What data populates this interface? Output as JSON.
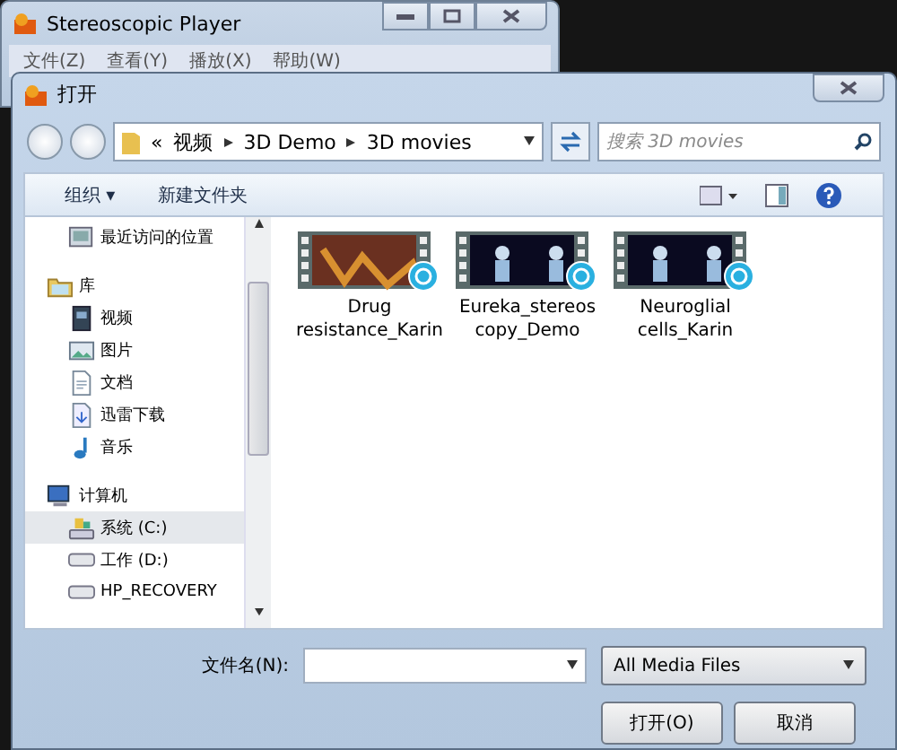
{
  "back_window": {
    "title": "Stereoscopic Player",
    "menu": [
      "文件(Z)",
      "查看(Y)",
      "播放(X)",
      "帮助(W)"
    ]
  },
  "dialog": {
    "title": "打开",
    "breadcrumb": {
      "overflow": "«",
      "parts": [
        "视频",
        "3D Demo",
        "3D movies"
      ]
    },
    "search": {
      "placeholder": "搜索 3D movies"
    },
    "toolbar": [
      "组织 ▾",
      "新建文件夹"
    ],
    "nav": [
      {
        "label": "最近访问的位置",
        "kind": "recent",
        "selected": false
      },
      {
        "label": "库",
        "kind": "library",
        "selected": false,
        "children": [
          {
            "label": "视频",
            "kind": "video",
            "selected": false
          },
          {
            "label": "图片",
            "kind": "picture",
            "selected": false
          },
          {
            "label": "文档",
            "kind": "document",
            "selected": false
          },
          {
            "label": "迅雷下载",
            "kind": "download",
            "selected": false
          },
          {
            "label": "音乐",
            "kind": "music",
            "selected": false
          }
        ]
      },
      {
        "label": "计算机",
        "kind": "computer",
        "selected": false,
        "children": [
          {
            "label": "系统 (C:)",
            "kind": "system-drive",
            "selected": true
          },
          {
            "label": "工作 (D:)",
            "kind": "drive",
            "selected": false
          },
          {
            "label": "HP_RECOVERY",
            "kind": "drive",
            "selected": false
          }
        ]
      }
    ],
    "files": [
      {
        "name_lines": [
          "Drug",
          "resistance_Karin"
        ],
        "kind": "warm"
      },
      {
        "name_lines": [
          "Eureka_stereos",
          "copy_Demo"
        ],
        "kind": "dark"
      },
      {
        "name_lines": [
          "Neuroglial",
          "cells_Karin"
        ],
        "kind": "dark"
      }
    ],
    "filename_label": "文件名(N):",
    "filter": "All Media Files",
    "buttons": [
      "打开(O)",
      "取消"
    ]
  }
}
